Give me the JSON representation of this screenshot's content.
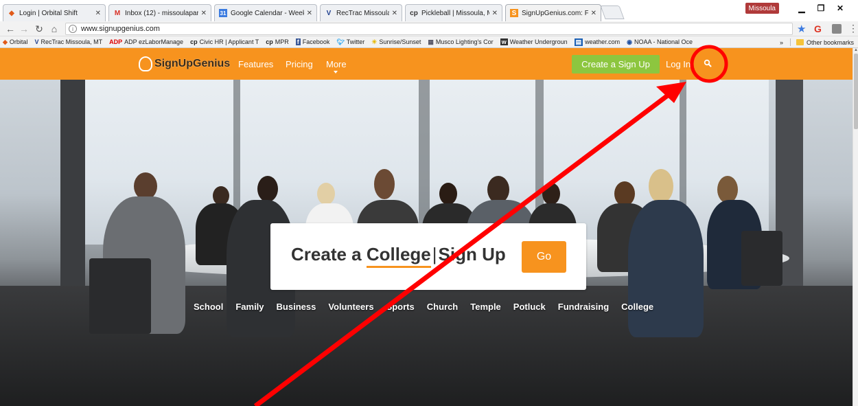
{
  "browser": {
    "tabs": [
      {
        "icon": "orbital-icon",
        "title": "Login | Orbital Shift",
        "active": false
      },
      {
        "icon": "gmail-icon",
        "title": "Inbox (12) - missoulapar",
        "active": false
      },
      {
        "icon": "calendar-icon",
        "title": "Google Calendar - Week",
        "active": false
      },
      {
        "icon": "rectrac-icon",
        "title": "RecTrac Missoula, MT",
        "active": false
      },
      {
        "icon": "civicplus-icon",
        "title": "Pickleball | Missoula, MT",
        "active": false
      },
      {
        "icon": "signupgenius-icon",
        "title": "SignUpGenius.com: Free",
        "active": true
      }
    ],
    "profile_label": "Missoula",
    "url": "www.signupgenius.com",
    "bookmarks": [
      {
        "icon": "orbital-icon",
        "label": "Orbital"
      },
      {
        "icon": "rectrac-icon",
        "label": "RecTrac Missoula, MT"
      },
      {
        "icon": "adp-icon",
        "label": "ADP ezLaborManage"
      },
      {
        "icon": "civicplus-icon",
        "label": "Civic HR | Applicant T"
      },
      {
        "icon": "civicplus-icon",
        "label": "MPR"
      },
      {
        "icon": "facebook-icon",
        "label": "Facebook"
      },
      {
        "icon": "twitter-icon",
        "label": "Twitter"
      },
      {
        "icon": "sun-icon",
        "label": "Sunrise/Sunset"
      },
      {
        "icon": "musco-icon",
        "label": "Musco Lighting's Cor"
      },
      {
        "icon": "weather-underground-icon",
        "label": "Weather Undergroun"
      },
      {
        "icon": "weathercom-icon",
        "label": "weather.com"
      },
      {
        "icon": "noaa-icon",
        "label": "NOAA - National Oce"
      }
    ],
    "overflow_label": "»",
    "other_bookmarks_label": "Other bookmarks"
  },
  "site": {
    "logo_text": "SignUpGenius",
    "nav": {
      "features": "Features",
      "pricing": "Pricing",
      "more": "More"
    },
    "create_button": "Create a Sign Up",
    "login": "Log In"
  },
  "hero": {
    "prefix": "Create a",
    "keyword": "College",
    "cursor": "|",
    "suffix": "Sign Up",
    "go": "Go",
    "categories": [
      "School",
      "Family",
      "Business",
      "Volunteers",
      "Sports",
      "Church",
      "Temple",
      "Potluck",
      "Fundraising",
      "College"
    ]
  },
  "colors": {
    "brand_orange": "#f7931e",
    "create_green": "#8dc63f",
    "annotation_red": "#ff0000"
  }
}
